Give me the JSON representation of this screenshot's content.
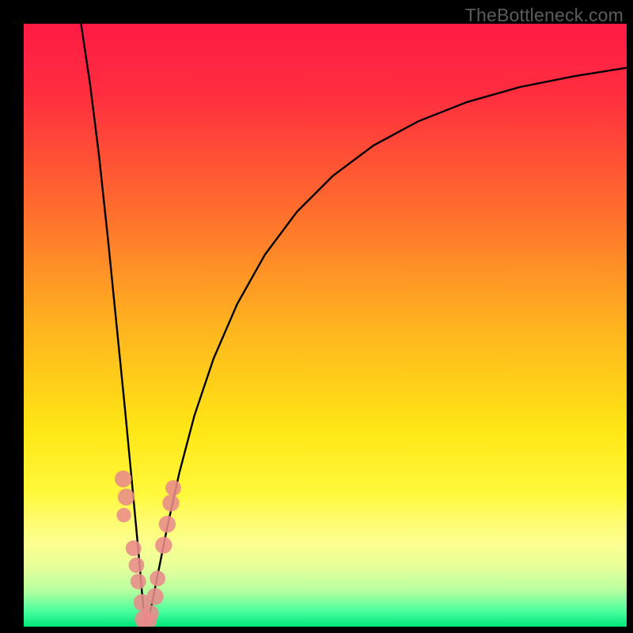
{
  "watermark": "TheBottleneck.com",
  "chart_data": {
    "type": "line",
    "title": "",
    "xlabel": "",
    "ylabel": "",
    "xlim": [
      0,
      100
    ],
    "ylim": [
      0,
      100
    ],
    "gradient_stops": [
      {
        "offset": 0.0,
        "color": "#ff1a44"
      },
      {
        "offset": 0.12,
        "color": "#ff2f3f"
      },
      {
        "offset": 0.3,
        "color": "#ff6a2e"
      },
      {
        "offset": 0.5,
        "color": "#ffb31f"
      },
      {
        "offset": 0.67,
        "color": "#ffe615"
      },
      {
        "offset": 0.78,
        "color": "#fff93b"
      },
      {
        "offset": 0.82,
        "color": "#fffb6a"
      },
      {
        "offset": 0.86,
        "color": "#fcff8e"
      },
      {
        "offset": 0.9,
        "color": "#e8ff9a"
      },
      {
        "offset": 0.94,
        "color": "#b7ffa0"
      },
      {
        "offset": 0.975,
        "color": "#49ff9d"
      },
      {
        "offset": 1.0,
        "color": "#00e67a"
      }
    ],
    "series": [
      {
        "name": "left-branch",
        "x": [
          9.5,
          11.0,
          12.5,
          14.0,
          15.5,
          16.8,
          17.8,
          18.6,
          19.2,
          19.6,
          19.9,
          20.1
        ],
        "y": [
          100,
          90.0,
          78.0,
          64.0,
          49.0,
          36.0,
          25.5,
          17.0,
          10.5,
          5.8,
          2.5,
          0.6
        ]
      },
      {
        "name": "right-branch",
        "x": [
          20.5,
          21.2,
          22.3,
          23.8,
          25.8,
          28.3,
          31.5,
          35.4,
          40.0,
          45.3,
          51.3,
          58.0,
          65.4,
          73.5,
          82.3,
          91.3,
          100.0
        ],
        "y": [
          0.6,
          3.5,
          9.0,
          16.5,
          25.5,
          35.0,
          44.5,
          53.5,
          61.7,
          68.8,
          74.8,
          79.8,
          83.8,
          87.0,
          89.5,
          91.3,
          92.7
        ]
      }
    ],
    "scatter_points": [
      {
        "x": 16.5,
        "y": 24.5,
        "r": 1.4
      },
      {
        "x": 17.0,
        "y": 21.5,
        "r": 1.4
      },
      {
        "x": 16.6,
        "y": 18.5,
        "r": 1.2
      },
      {
        "x": 18.2,
        "y": 13.0,
        "r": 1.3
      },
      {
        "x": 18.7,
        "y": 10.2,
        "r": 1.3
      },
      {
        "x": 19.0,
        "y": 7.5,
        "r": 1.3
      },
      {
        "x": 19.6,
        "y": 4.0,
        "r": 1.4
      },
      {
        "x": 19.9,
        "y": 1.2,
        "r": 1.5
      },
      {
        "x": 20.6,
        "y": 1.0,
        "r": 1.5
      },
      {
        "x": 21.0,
        "y": 2.2,
        "r": 1.4
      },
      {
        "x": 21.8,
        "y": 5.0,
        "r": 1.4
      },
      {
        "x": 22.2,
        "y": 8.0,
        "r": 1.3
      },
      {
        "x": 23.2,
        "y": 13.5,
        "r": 1.4
      },
      {
        "x": 23.8,
        "y": 17.0,
        "r": 1.4
      },
      {
        "x": 24.4,
        "y": 20.5,
        "r": 1.4
      },
      {
        "x": 24.8,
        "y": 23.0,
        "r": 1.3
      }
    ],
    "scatter_color": "#e98b8b"
  }
}
